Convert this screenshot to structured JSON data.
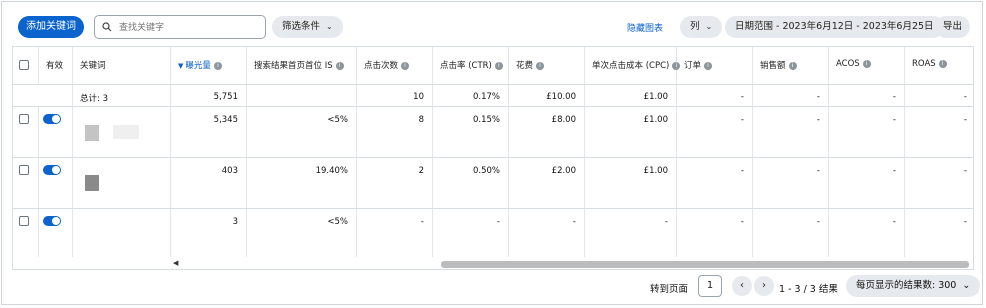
{
  "toolbar": {
    "add_keyword": "添加关键词",
    "search_placeholder": "查找关键字",
    "filter_label": "筛选条件",
    "hide_chart": "隐藏图表",
    "columns_label": "列",
    "date_range": "日期范围 - 2023年6月12日 - 2023年6月25日",
    "export_label": "导出"
  },
  "table": {
    "headers": {
      "active": "有效",
      "keyword": "关键词",
      "impressions": "曝光量",
      "top_is": "搜索结果首页首位 IS",
      "clicks": "点击次数",
      "ctr": "点击率 (CTR)",
      "spend": "花费",
      "cpc": "单次点击成本 (CPC)",
      "orders": "订单",
      "sales": "销售额",
      "acos": "ACOS",
      "roas": "ROAS"
    },
    "summary": {
      "label": "总计: 3",
      "impressions": "5,751",
      "top_is": "",
      "clicks": "10",
      "ctr": "0.17%",
      "spend": "£10.00",
      "cpc": "£1.00",
      "orders": "-",
      "sales": "-",
      "acos": "-",
      "roas": "-"
    },
    "rows": [
      {
        "impressions": "5,345",
        "top_is": "<5%",
        "clicks": "8",
        "ctr": "0.15%",
        "spend": "£8.00",
        "cpc": "£1.00",
        "orders": "-",
        "sales": "-",
        "acos": "-",
        "roas": "-"
      },
      {
        "impressions": "403",
        "top_is": "19.40%",
        "clicks": "2",
        "ctr": "0.50%",
        "spend": "£2.00",
        "cpc": "£1.00",
        "orders": "-",
        "sales": "-",
        "acos": "-",
        "roas": "-"
      },
      {
        "impressions": "3",
        "top_is": "<5%",
        "clicks": "-",
        "ctr": "-",
        "spend": "-",
        "cpc": "-",
        "orders": "-",
        "sales": "-",
        "acos": "-",
        "roas": "-"
      }
    ]
  },
  "footer": {
    "goto_label": "转到页面",
    "page_value": "1",
    "range_text": "1 - 3 / 3 结果",
    "per_page": "每页显示的结果数: 300"
  },
  "colors": {
    "accent": "#0b63ce"
  }
}
